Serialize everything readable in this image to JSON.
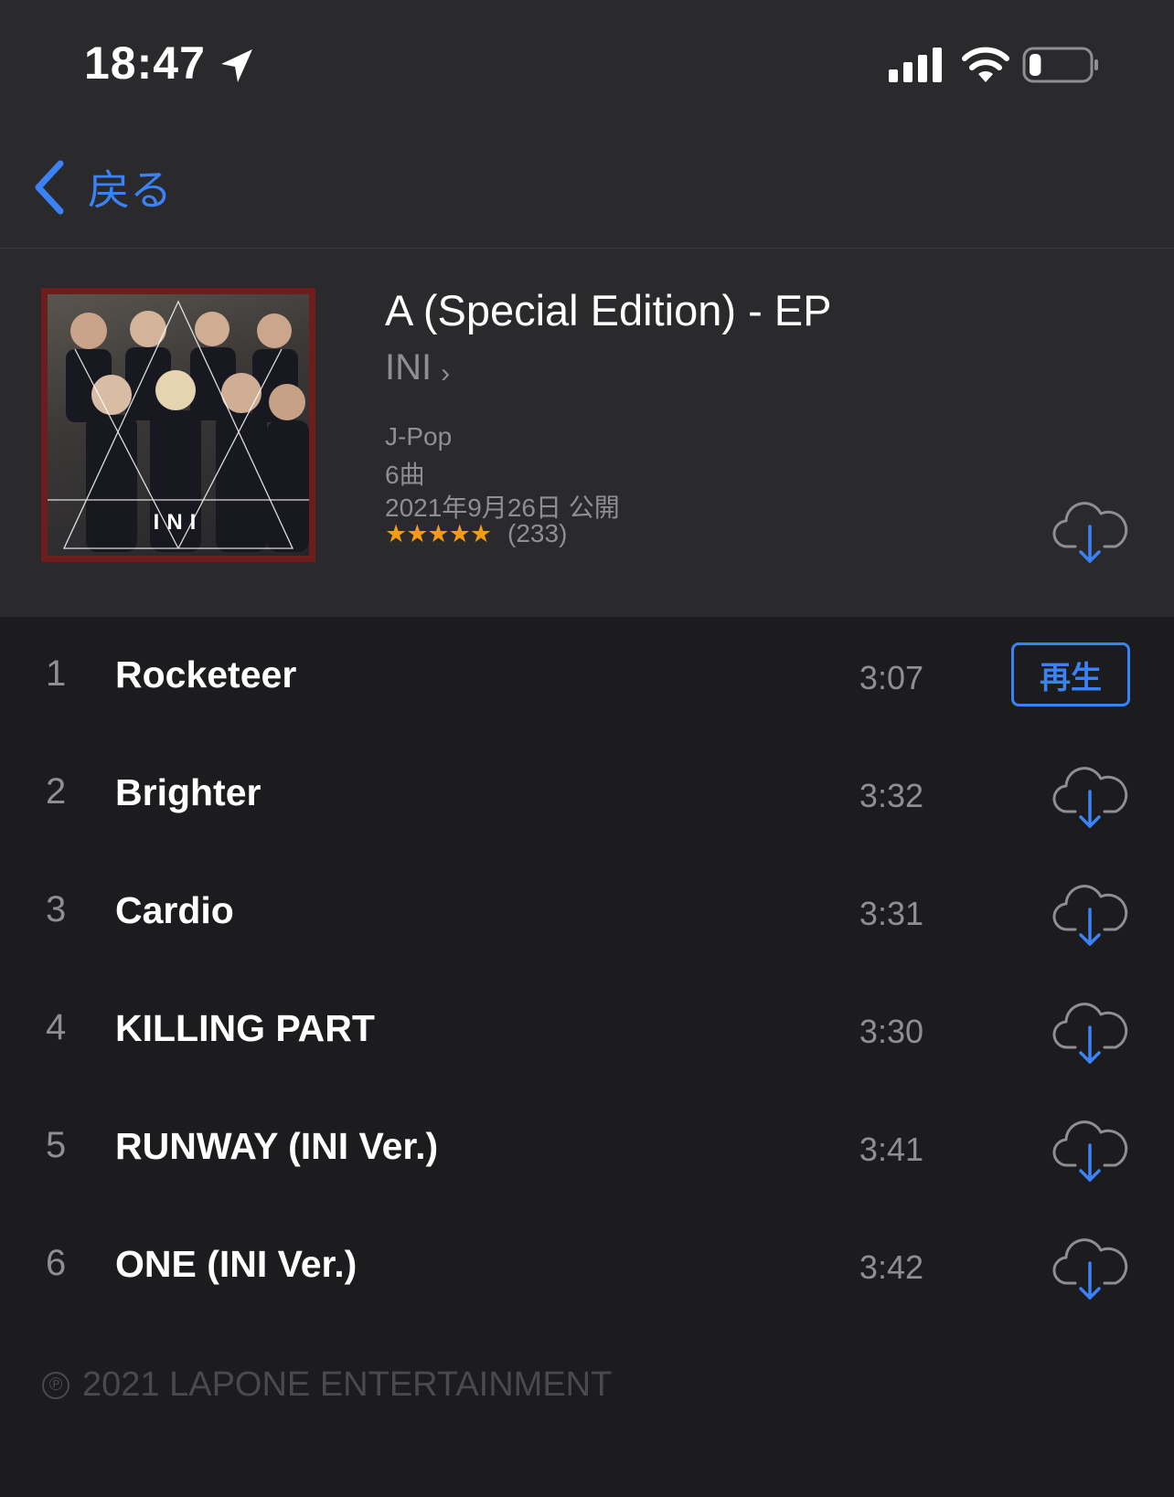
{
  "status_bar": {
    "time": "18:47",
    "battery_level": 0.2
  },
  "nav": {
    "back_label": "戻る"
  },
  "album": {
    "title": "A (Special Edition) - EP",
    "artist": "INI",
    "artwork_logo": "INI",
    "genre": "J-Pop",
    "track_count": "6曲",
    "released": "2021年9月26日 公開",
    "stars": "★★★★★",
    "rating_value": 5,
    "rating_count": "(233)"
  },
  "tracks": [
    {
      "number": "1",
      "title": "Rocketeer",
      "duration": "3:07",
      "action": "再生"
    },
    {
      "number": "2",
      "title": "Brighter",
      "duration": "3:32"
    },
    {
      "number": "3",
      "title": "Cardio",
      "duration": "3:31"
    },
    {
      "number": "4",
      "title": "KILLING PART",
      "duration": "3:30"
    },
    {
      "number": "5",
      "title": "RUNWAY (INI Ver.)",
      "duration": "3:41"
    },
    {
      "number": "6",
      "title": "ONE (INI Ver.)",
      "duration": "3:42"
    }
  ],
  "footer": {
    "copyright_symbol": "℗",
    "copyright": "2021 LAPONE ENTERTAINMENT"
  },
  "icons": [
    "location-arrow-icon",
    "signal-icon",
    "wifi-icon",
    "battery-icon",
    "back-chevron-icon",
    "chevron-right-icon",
    "cloud-download-icon"
  ],
  "colors": {
    "accent": "#3b82f6",
    "background": "#1c1c1e",
    "header_background": "#2a2a2c",
    "star": "#f39c12",
    "artwork_border": "#6e1d1d"
  }
}
